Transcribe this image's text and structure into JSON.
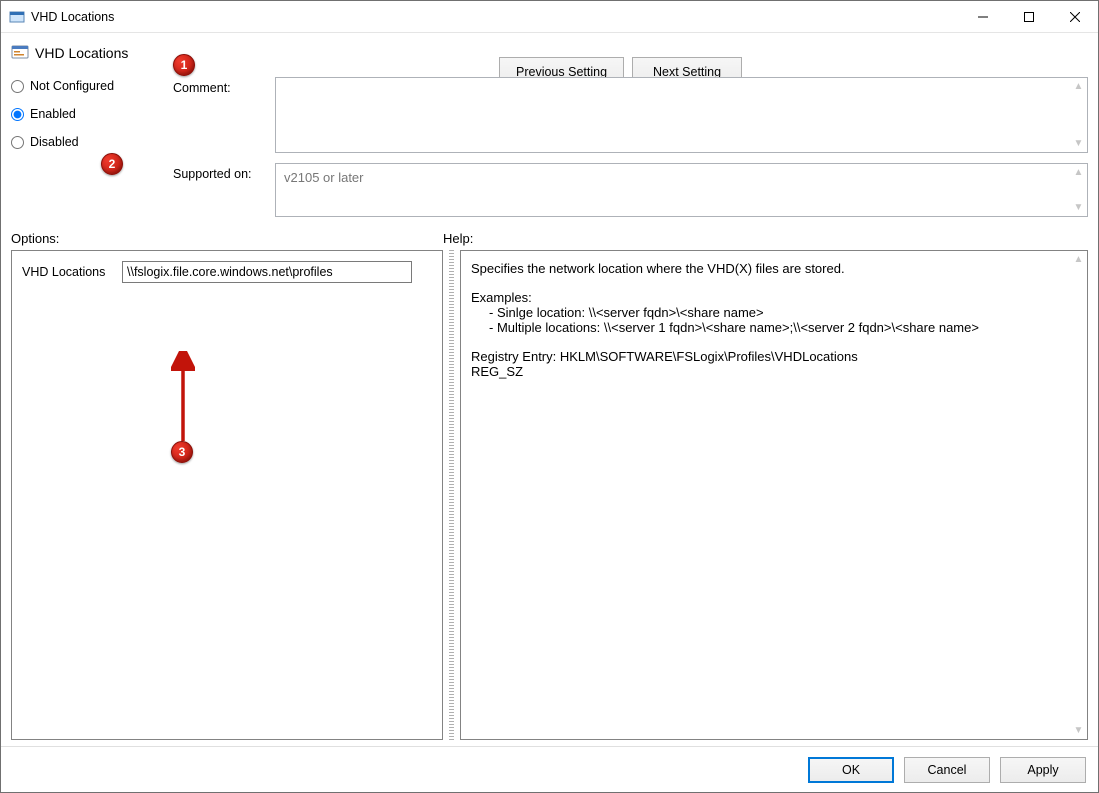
{
  "window": {
    "title": "VHD Locations"
  },
  "policy": {
    "title": "VHD Locations"
  },
  "nav": {
    "prev": "Previous Setting",
    "next": "Next Setting"
  },
  "state": {
    "not_configured": "Not Configured",
    "enabled": "Enabled",
    "disabled": "Disabled",
    "selected": "enabled"
  },
  "labels": {
    "comment": "Comment:",
    "supported_on": "Supported on:",
    "options": "Options:",
    "help": "Help:"
  },
  "supported": {
    "text": "v2105 or later"
  },
  "options": {
    "field_label": "VHD Locations",
    "field_value": "\\\\fslogix.file.core.windows.net\\profiles"
  },
  "help": {
    "intro": "Specifies the network location where the VHD(X) files are stored.",
    "examples_header": "Examples:",
    "example1": "- Sinlge location:  \\\\<server fqdn>\\<share name>",
    "example2": "- Multiple locations: \\\\<server 1 fqdn>\\<share name>;\\\\<server 2 fqdn>\\<share name>",
    "registry": "Registry Entry:  HKLM\\SOFTWARE\\FSLogix\\Profiles\\VHDLocations",
    "reg_type": "REG_SZ"
  },
  "footer": {
    "ok": "OK",
    "cancel": "Cancel",
    "apply": "Apply"
  },
  "annotations": {
    "b1": "1",
    "b2": "2",
    "b3": "3"
  }
}
